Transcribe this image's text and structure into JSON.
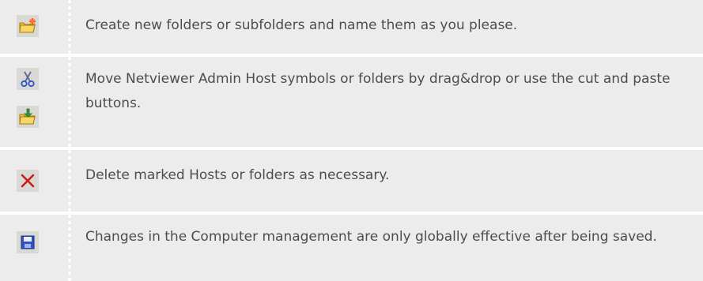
{
  "rows": [
    {
      "icon": "new-folder-icon",
      "text": "Create new folders or subfolders and name them as you please."
    },
    {
      "icons": [
        "cut-icon",
        "paste-folder-icon"
      ],
      "text": "Move Netviewer Admin Host symbols or folders by drag&drop or use the cut and paste buttons."
    },
    {
      "icon": "delete-icon",
      "text": "Delete marked Hosts or folders as necessary."
    },
    {
      "icon": "save-icon",
      "text": "Changes in the Computer management are only globally effective after being saved."
    }
  ],
  "colors": {
    "row_background": "#ececec",
    "text": "#4d4d4d",
    "icon_background": "#d8d8d4",
    "delete_red": "#d11b1b",
    "save_blue": "#2f52c9",
    "folder_yellow": "#f3c33a"
  }
}
